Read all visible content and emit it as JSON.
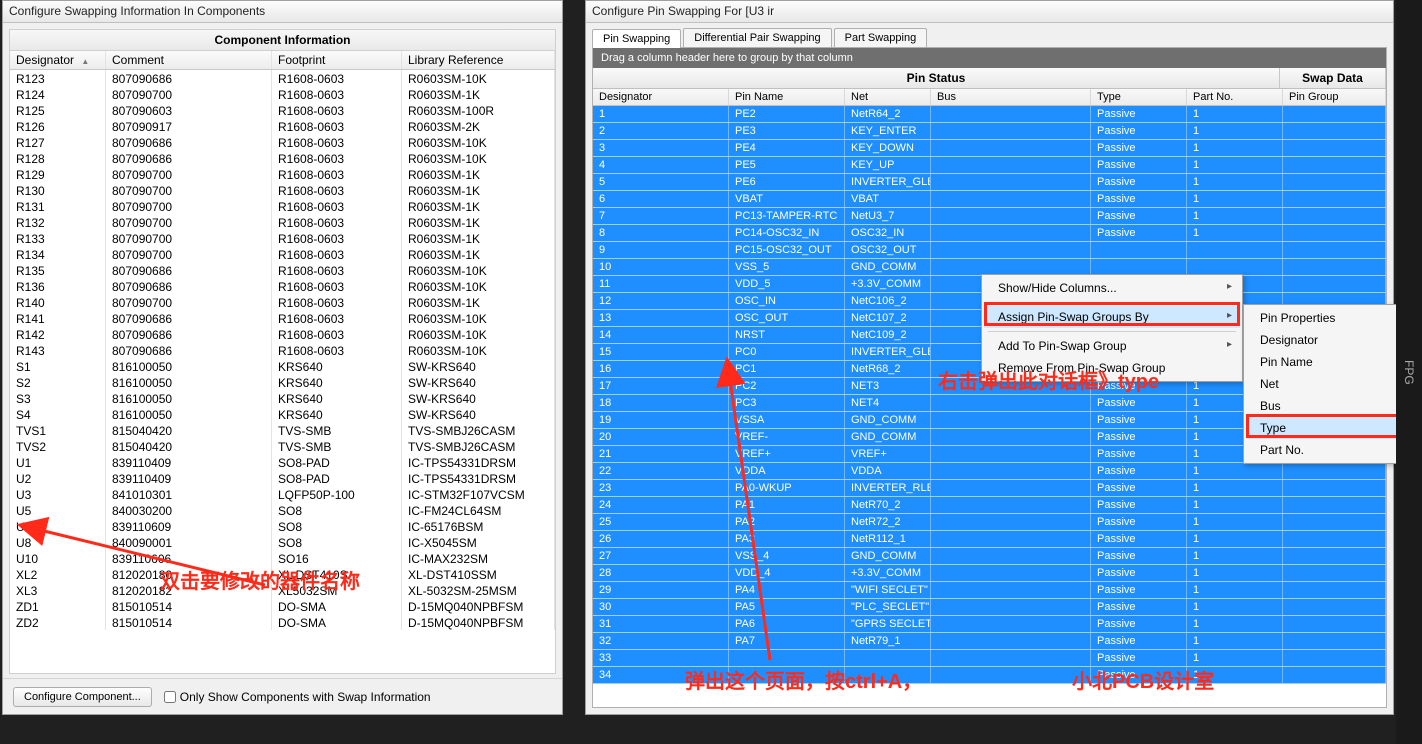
{
  "left": {
    "title": "Configure Swapping Information In Components",
    "panel_title": "Component Information",
    "headers": {
      "designator": "Designator",
      "comment": "Comment",
      "footprint": "Footprint",
      "lib": "Library Reference"
    },
    "sort_glyph": "▲",
    "rows": [
      {
        "d": "R123",
        "c": "807090686",
        "f": "R1608-0603",
        "l": "R0603SM-10K"
      },
      {
        "d": "R124",
        "c": "807090700",
        "f": "R1608-0603",
        "l": "R0603SM-1K"
      },
      {
        "d": "R125",
        "c": "807090603",
        "f": "R1608-0603",
        "l": "R0603SM-100R"
      },
      {
        "d": "R126",
        "c": "807090917",
        "f": "R1608-0603",
        "l": "R0603SM-2K"
      },
      {
        "d": "R127",
        "c": "807090686",
        "f": "R1608-0603",
        "l": "R0603SM-10K"
      },
      {
        "d": "R128",
        "c": "807090686",
        "f": "R1608-0603",
        "l": "R0603SM-10K"
      },
      {
        "d": "R129",
        "c": "807090700",
        "f": "R1608-0603",
        "l": "R0603SM-1K"
      },
      {
        "d": "R130",
        "c": "807090700",
        "f": "R1608-0603",
        "l": "R0603SM-1K"
      },
      {
        "d": "R131",
        "c": "807090700",
        "f": "R1608-0603",
        "l": "R0603SM-1K"
      },
      {
        "d": "R132",
        "c": "807090700",
        "f": "R1608-0603",
        "l": "R0603SM-1K"
      },
      {
        "d": "R133",
        "c": "807090700",
        "f": "R1608-0603",
        "l": "R0603SM-1K"
      },
      {
        "d": "R134",
        "c": "807090700",
        "f": "R1608-0603",
        "l": "R0603SM-1K"
      },
      {
        "d": "R135",
        "c": "807090686",
        "f": "R1608-0603",
        "l": "R0603SM-10K"
      },
      {
        "d": "R136",
        "c": "807090686",
        "f": "R1608-0603",
        "l": "R0603SM-10K"
      },
      {
        "d": "R140",
        "c": "807090700",
        "f": "R1608-0603",
        "l": "R0603SM-1K"
      },
      {
        "d": "R141",
        "c": "807090686",
        "f": "R1608-0603",
        "l": "R0603SM-10K"
      },
      {
        "d": "R142",
        "c": "807090686",
        "f": "R1608-0603",
        "l": "R0603SM-10K"
      },
      {
        "d": "R143",
        "c": "807090686",
        "f": "R1608-0603",
        "l": "R0603SM-10K"
      },
      {
        "d": "S1",
        "c": "816100050",
        "f": "KRS640",
        "l": "SW-KRS640"
      },
      {
        "d": "S2",
        "c": "816100050",
        "f": "KRS640",
        "l": "SW-KRS640"
      },
      {
        "d": "S3",
        "c": "816100050",
        "f": "KRS640",
        "l": "SW-KRS640"
      },
      {
        "d": "S4",
        "c": "816100050",
        "f": "KRS640",
        "l": "SW-KRS640"
      },
      {
        "d": "TVS1",
        "c": "815040420",
        "f": "TVS-SMB",
        "l": "TVS-SMBJ26CASM"
      },
      {
        "d": "TVS2",
        "c": "815040420",
        "f": "TVS-SMB",
        "l": "TVS-SMBJ26CASM"
      },
      {
        "d": "U1",
        "c": "839110409",
        "f": "SO8-PAD",
        "l": "IC-TPS54331DRSM"
      },
      {
        "d": "U2",
        "c": "839110409",
        "f": "SO8-PAD",
        "l": "IC-TPS54331DRSM"
      },
      {
        "d": "U3",
        "c": "841010301",
        "f": "LQFP50P-100",
        "l": "IC-STM32F107VCSM"
      },
      {
        "d": "U5",
        "c": "840030200",
        "f": "SO8",
        "l": "IC-FM24CL64SM"
      },
      {
        "d": "U6",
        "c": "839110609",
        "f": "SO8",
        "l": "IC-65176BSM"
      },
      {
        "d": "U8",
        "c": "840090001",
        "f": "SO8",
        "l": "IC-X5045SM"
      },
      {
        "d": "U10",
        "c": "839110606",
        "f": "SO16",
        "l": "IC-MAX232SM"
      },
      {
        "d": "XL2",
        "c": "812020180",
        "f": "XL DST410S",
        "l": "XL-DST410SSM"
      },
      {
        "d": "XL3",
        "c": "812020182",
        "f": "XL5032SM",
        "l": "XL-5032SM-25MSM"
      },
      {
        "d": "ZD1",
        "c": "815010514",
        "f": "DO-SMA",
        "l": "D-15MQ040NPBFSM"
      },
      {
        "d": "ZD2",
        "c": "815010514",
        "f": "DO-SMA",
        "l": "D-15MQ040NPBFSM"
      }
    ],
    "footer": {
      "btn": "Configure Component...",
      "chk": "Only Show Components with Swap Information"
    }
  },
  "right": {
    "title": "Configure Pin Swapping For [U3 ir",
    "tabs": [
      "Pin Swapping",
      "Differential Pair Swapping",
      "Part Swapping"
    ],
    "group_hint": "Drag a column header here to group by that column",
    "bands": {
      "status": "Pin Status",
      "swap": "Swap Data"
    },
    "headers": {
      "des": "Designator",
      "name": "Pin Name",
      "net": "Net",
      "bus": "Bus",
      "type": "Type",
      "part": "Part No.",
      "group": "Pin Group"
    },
    "rows": [
      {
        "d": "1",
        "n": "PE2",
        "net": "NetR64_2",
        "bus": "",
        "t": "Passive",
        "p": "1",
        "g": ""
      },
      {
        "d": "2",
        "n": "PE3",
        "net": "KEY_ENTER",
        "bus": "",
        "t": "Passive",
        "p": "1",
        "g": ""
      },
      {
        "d": "3",
        "n": "PE4",
        "net": "KEY_DOWN",
        "bus": "",
        "t": "Passive",
        "p": "1",
        "g": ""
      },
      {
        "d": "4",
        "n": "PE5",
        "net": "KEY_UP",
        "bus": "",
        "t": "Passive",
        "p": "1",
        "g": ""
      },
      {
        "d": "5",
        "n": "PE6",
        "net": "INVERTER_GLE",
        "bus": "",
        "t": "Passive",
        "p": "1",
        "g": ""
      },
      {
        "d": "6",
        "n": "VBAT",
        "net": "VBAT",
        "bus": "",
        "t": "Passive",
        "p": "1",
        "g": ""
      },
      {
        "d": "7",
        "n": "PC13-TAMPER-RTC",
        "net": "NetU3_7",
        "bus": "",
        "t": "Passive",
        "p": "1",
        "g": ""
      },
      {
        "d": "8",
        "n": "PC14-OSC32_IN",
        "net": "OSC32_IN",
        "bus": "",
        "t": "Passive",
        "p": "1",
        "g": ""
      },
      {
        "d": "9",
        "n": "PC15-OSC32_OUT",
        "net": "OSC32_OUT",
        "bus": "",
        "t": "",
        "p": "",
        "g": ""
      },
      {
        "d": "10",
        "n": "VSS_5",
        "net": "GND_COMM",
        "bus": "",
        "t": "",
        "p": "",
        "g": ""
      },
      {
        "d": "11",
        "n": "VDD_5",
        "net": "+3.3V_COMM",
        "bus": "",
        "t": "",
        "p": "",
        "g": ""
      },
      {
        "d": "12",
        "n": "OSC_IN",
        "net": "NetC106_2",
        "bus": "",
        "t": "",
        "p": "",
        "g": ""
      },
      {
        "d": "13",
        "n": "OSC_OUT",
        "net": "NetC107_2",
        "bus": "",
        "t": "",
        "p": "",
        "g": ""
      },
      {
        "d": "14",
        "n": "NRST",
        "net": "NetC109_2",
        "bus": "",
        "t": "",
        "p": "",
        "g": ""
      },
      {
        "d": "15",
        "n": "PC0",
        "net": "INVERTER_GLE",
        "bus": "",
        "t": "",
        "p": "",
        "g": ""
      },
      {
        "d": "16",
        "n": "PC1",
        "net": "NetR68_2",
        "bus": "",
        "t": "Passive",
        "p": "1",
        "g": ""
      },
      {
        "d": "17",
        "n": "PC2",
        "net": "NET3",
        "bus": "",
        "t": "Passive",
        "p": "1",
        "g": ""
      },
      {
        "d": "18",
        "n": "PC3",
        "net": "NET4",
        "bus": "",
        "t": "Passive",
        "p": "1",
        "g": ""
      },
      {
        "d": "19",
        "n": "VSSA",
        "net": "GND_COMM",
        "bus": "",
        "t": "Passive",
        "p": "1",
        "g": ""
      },
      {
        "d": "20",
        "n": "VREF-",
        "net": "GND_COMM",
        "bus": "",
        "t": "Passive",
        "p": "1",
        "g": ""
      },
      {
        "d": "21",
        "n": "VREF+",
        "net": "VREF+",
        "bus": "",
        "t": "Passive",
        "p": "1",
        "g": ""
      },
      {
        "d": "22",
        "n": "VDDA",
        "net": "VDDA",
        "bus": "",
        "t": "Passive",
        "p": "1",
        "g": ""
      },
      {
        "d": "23",
        "n": "PA0-WKUP",
        "net": "INVERTER_RLE",
        "bus": "",
        "t": "Passive",
        "p": "1",
        "g": ""
      },
      {
        "d": "24",
        "n": "PA1",
        "net": "NetR70_2",
        "bus": "",
        "t": "Passive",
        "p": "1",
        "g": ""
      },
      {
        "d": "25",
        "n": "PA2",
        "net": "NetR72_2",
        "bus": "",
        "t": "Passive",
        "p": "1",
        "g": ""
      },
      {
        "d": "26",
        "n": "PA3",
        "net": "NetR112_1",
        "bus": "",
        "t": "Passive",
        "p": "1",
        "g": ""
      },
      {
        "d": "27",
        "n": "VSS_4",
        "net": "GND_COMM",
        "bus": "",
        "t": "Passive",
        "p": "1",
        "g": ""
      },
      {
        "d": "28",
        "n": "VDD_4",
        "net": "+3.3V_COMM",
        "bus": "",
        "t": "Passive",
        "p": "1",
        "g": ""
      },
      {
        "d": "29",
        "n": "PA4",
        "net": "\"WIFI SECLET\"",
        "bus": "",
        "t": "Passive",
        "p": "1",
        "g": ""
      },
      {
        "d": "30",
        "n": "PA5",
        "net": "\"PLC_SECLET\"",
        "bus": "",
        "t": "Passive",
        "p": "1",
        "g": ""
      },
      {
        "d": "31",
        "n": "PA6",
        "net": "\"GPRS SECLET\"",
        "bus": "",
        "t": "Passive",
        "p": "1",
        "g": ""
      },
      {
        "d": "32",
        "n": "PA7",
        "net": "NetR79_1",
        "bus": "",
        "t": "Passive",
        "p": "1",
        "g": ""
      },
      {
        "d": "33",
        "n": "",
        "net": "",
        "bus": "",
        "t": "Passive",
        "p": "1",
        "g": ""
      },
      {
        "d": "34",
        "n": "",
        "net": "",
        "bus": "",
        "t": "Passive",
        "p": "1",
        "g": ""
      }
    ]
  },
  "menu1": {
    "items": [
      {
        "label": "Show/Hide Columns...",
        "arrow": true
      },
      {
        "label": "Assign Pin-Swap Groups By",
        "arrow": true,
        "hl": true
      },
      {
        "label": "Add To Pin-Swap Group",
        "arrow": true
      },
      {
        "label": "Remove From Pin-Swap Group"
      }
    ]
  },
  "menu2": {
    "items": [
      {
        "label": "Pin Properties"
      },
      {
        "label": "Designator"
      },
      {
        "label": "Pin Name"
      },
      {
        "label": "Net"
      },
      {
        "label": "Bus"
      },
      {
        "label": "Type",
        "hl": true
      },
      {
        "label": "Part No."
      }
    ]
  },
  "annotations": {
    "a1": "双击要修改的器件名称",
    "a2": "右击弹出此对话框》type",
    "a3": "弹出这个页面，按ctrl+A，",
    "a4": "小北PCB设计室"
  },
  "sidebar_label": "FPG"
}
